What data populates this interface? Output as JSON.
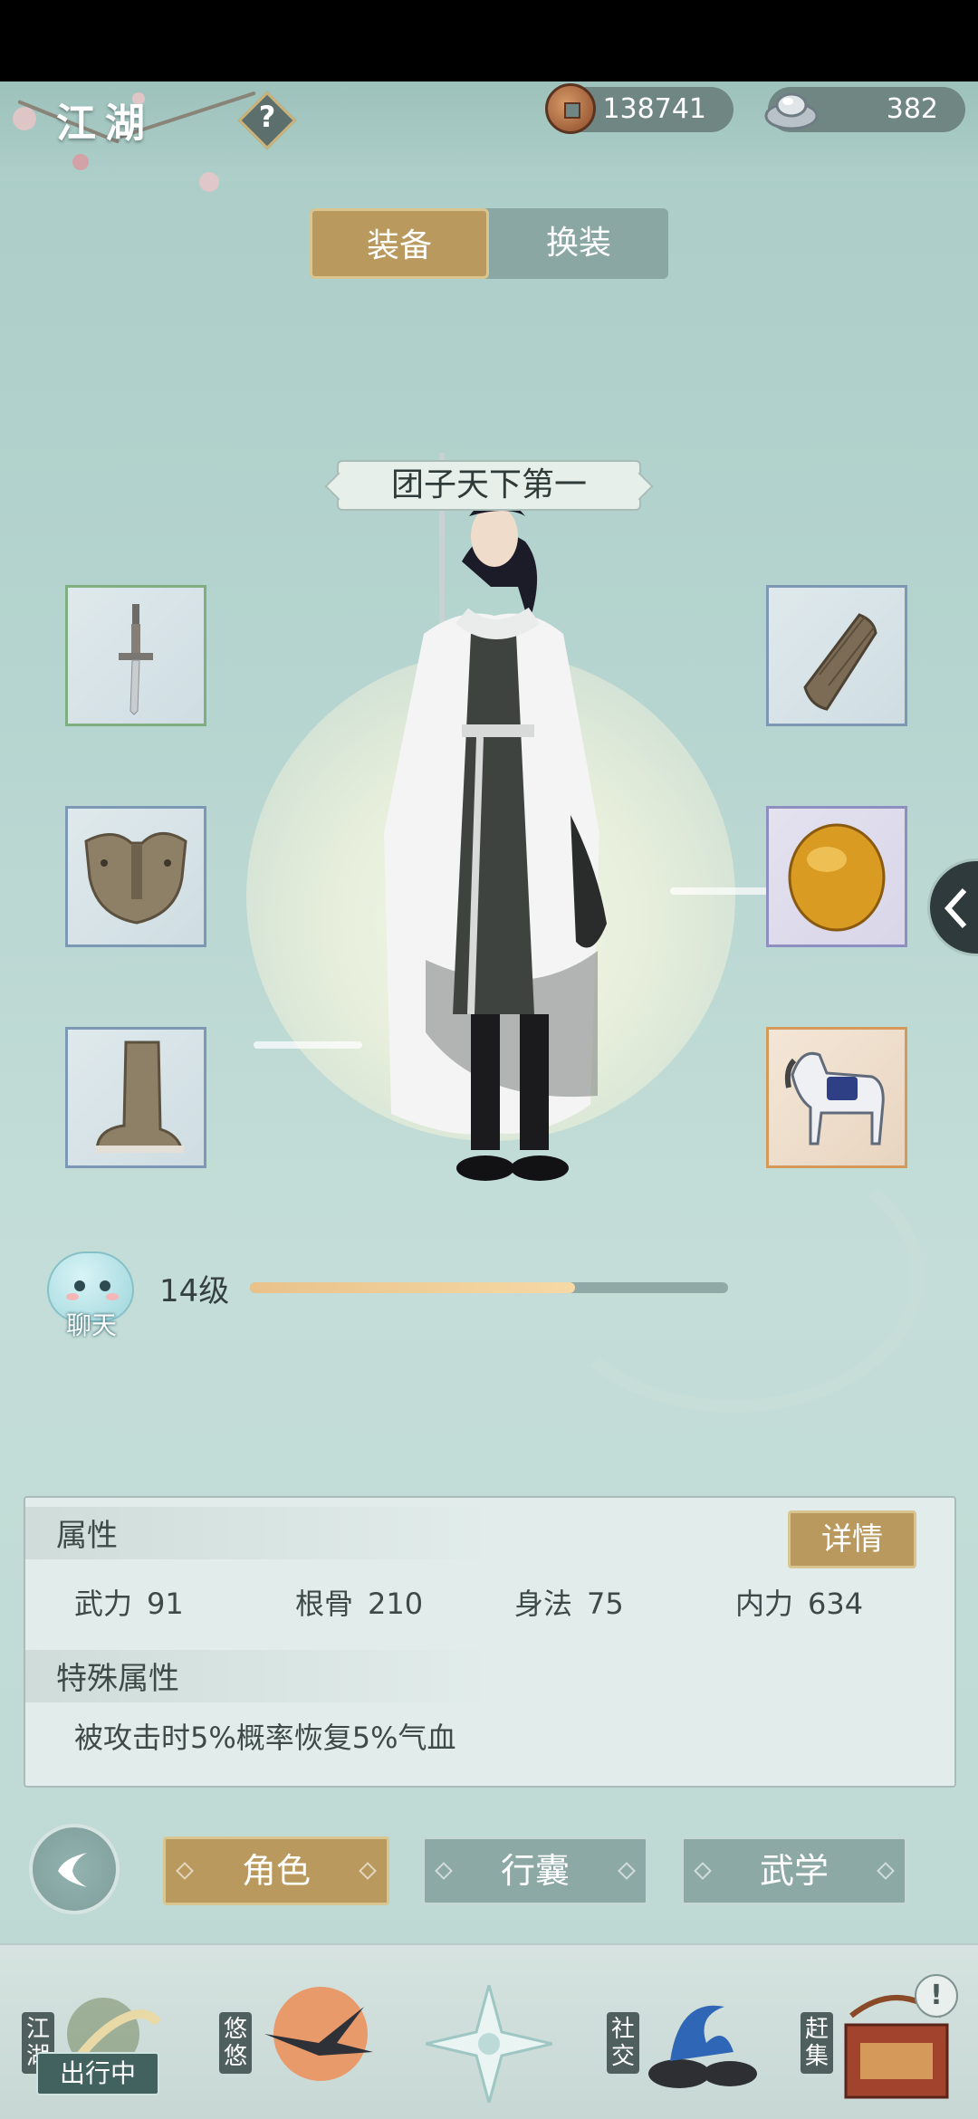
{
  "header": {
    "title": "江湖",
    "help_icon": "question-mark-icon",
    "copper": {
      "icon": "copper-coin-icon",
      "value": "138741"
    },
    "silver": {
      "icon": "silver-ingot-icon",
      "value": "382"
    }
  },
  "tabs": {
    "equip": "装备",
    "outfit": "换装",
    "active": "装备"
  },
  "character": {
    "name": "团子天下第一"
  },
  "slots": {
    "left": [
      {
        "icon": "sword-icon",
        "rarity_color": "#7fae80"
      },
      {
        "icon": "armor-icon",
        "rarity_color": "#7c98b4"
      },
      {
        "icon": "boots-icon",
        "rarity_color": "#7c98b4"
      }
    ],
    "right": [
      {
        "icon": "bracer-icon",
        "rarity_color": "#7c98b4"
      },
      {
        "icon": "amber-gem-icon",
        "rarity_color": "#8f8ec0"
      },
      {
        "icon": "horse-mount-icon",
        "rarity_color": "#d59a5a"
      }
    ]
  },
  "chat": {
    "label": "聊天"
  },
  "level": {
    "text": "14级",
    "progress": 0.68
  },
  "attributes": {
    "title": "属性",
    "detail_button": "详情",
    "stats": [
      {
        "name": "武力",
        "value": "91"
      },
      {
        "name": "根骨",
        "value": "210"
      },
      {
        "name": "身法",
        "value": "75"
      },
      {
        "name": "内力",
        "value": "634"
      }
    ],
    "special_title": "特殊属性",
    "special_text": "被攻击时5%概率恢复5%气血"
  },
  "actions": {
    "role": "角色",
    "bag": "行囊",
    "martial": "武学",
    "active": "角色"
  },
  "bottom_nav": {
    "items": [
      {
        "label": "江湖",
        "badge": "出行中"
      },
      {
        "label": "悠悠"
      },
      {
        "label": ""
      },
      {
        "label": "社交"
      },
      {
        "label": "赶集",
        "alert": "!"
      }
    ]
  },
  "colors": {
    "accent_gold": "#b9995d",
    "panel_bg": "#e8f0ee",
    "bg_teal": "#b5d4cf"
  }
}
